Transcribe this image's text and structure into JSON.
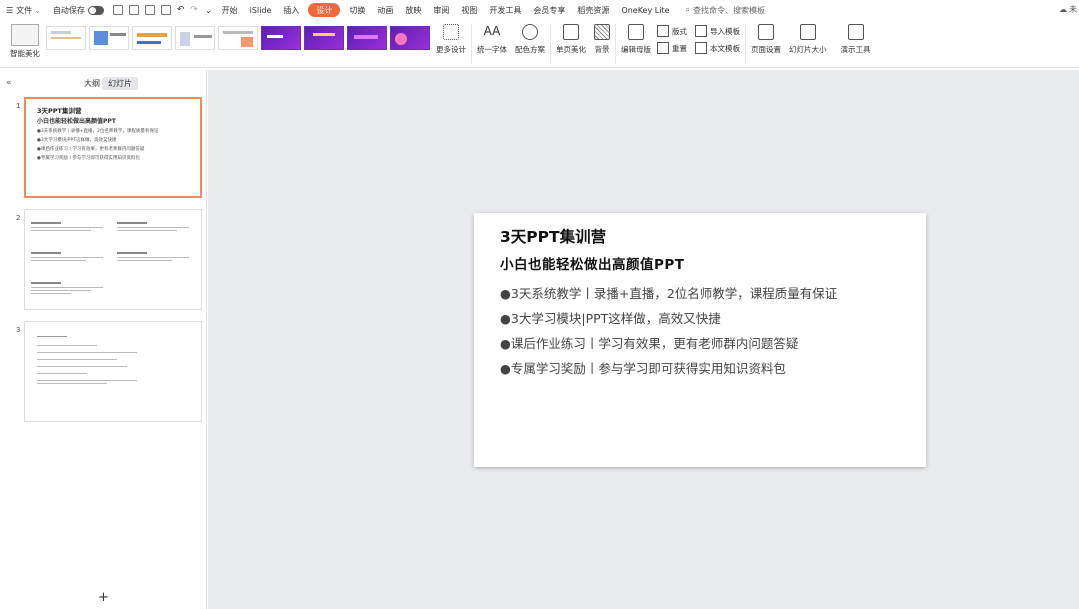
{
  "menubar": {
    "file": "文件",
    "autosave": "自动保存",
    "items": [
      "开始",
      "iSlide",
      "插入",
      "设计",
      "切换",
      "动画",
      "放映",
      "审阅",
      "视图",
      "开发工具",
      "会员专享",
      "稻壳资源",
      "OneKey Lite"
    ],
    "active": "设计",
    "search": "查找命令、搜索模板",
    "right": "未"
  },
  "toolbar": {
    "smart_beautify": "智能美化",
    "more_design": "更多设计",
    "unify_font": "统一字体",
    "color_scheme": "配色方案",
    "single_page": "单页美化",
    "background": "背景",
    "edit_master": "编辑母版",
    "layout": "版式",
    "reset": "重置",
    "import_template": "导入模板",
    "this_template": "本文模板",
    "page_setup": "页面设置",
    "slide_size": "幻灯片大小",
    "presentation_tools": "演示工具"
  },
  "panel": {
    "tab_outline": "大纲",
    "tab_slides": "幻灯片",
    "slides": [
      {
        "num": "1",
        "title": "3天PPT集训营",
        "subtitle": "小白也能轻松做出高颜值PPT",
        "bullets": [
          "●3天系统教学丨录播+直播，2位名师教学，课程质量有保证",
          "●3大学习模块|PPT这样做，高效又快捷",
          "●课后作业练习丨学习有效果，更有老师群内问题答疑",
          "●专属学习奖励丨参与学习即可获得实用知识资料包"
        ]
      },
      {
        "num": "2"
      },
      {
        "num": "3"
      }
    ]
  },
  "slide": {
    "title": "3天PPT集训营",
    "subtitle": "小白也能轻松做出高颜值PPT",
    "bullets": [
      "●3天系统教学丨录播+直播，2位名师教学，课程质量有保证",
      "●3大学习模块|PPT这样做，高效又快捷",
      "●课后作业练习丨学习有效果，更有老师群内问题答疑",
      "●专属学习奖励丨参与学习即可获得实用知识资料包"
    ]
  },
  "colors": {
    "accent": "#f2683a",
    "selected_border": "#f08a5d",
    "canvas_bg": "#e9ebee"
  }
}
